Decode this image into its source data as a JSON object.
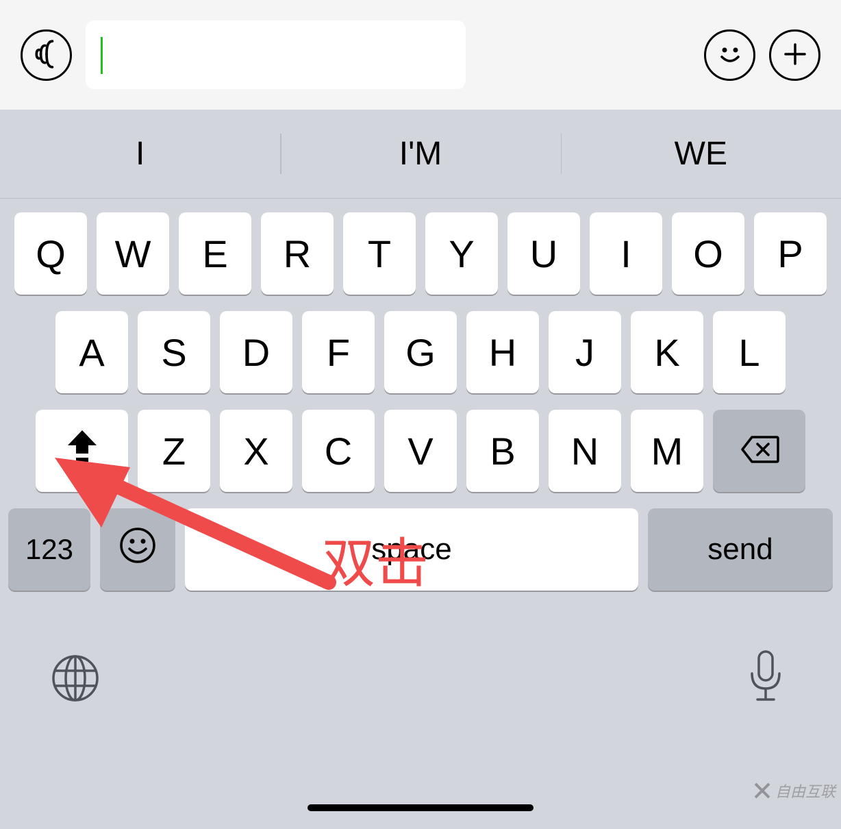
{
  "topbar": {
    "input_value": ""
  },
  "suggestions": [
    "I",
    "I'M",
    "WE"
  ],
  "rows": {
    "r1": [
      "Q",
      "W",
      "E",
      "R",
      "T",
      "Y",
      "U",
      "I",
      "O",
      "P"
    ],
    "r2": [
      "A",
      "S",
      "D",
      "F",
      "G",
      "H",
      "J",
      "K",
      "L"
    ],
    "r3": [
      "Z",
      "X",
      "C",
      "V",
      "B",
      "N",
      "M"
    ]
  },
  "special": {
    "numeric": "123",
    "space": "space",
    "send": "send"
  },
  "annotation": {
    "text": "双击"
  },
  "watermark": "自由互联"
}
